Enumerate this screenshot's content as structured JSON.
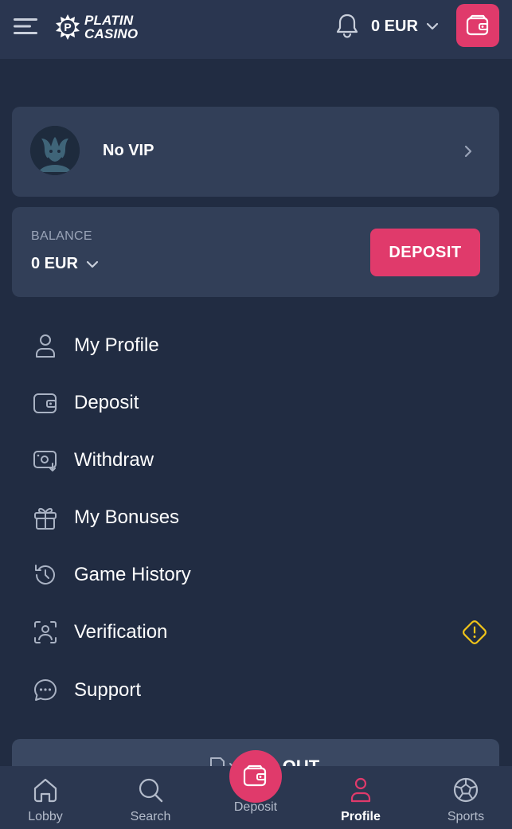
{
  "header": {
    "brand_line1": "PLATIN",
    "brand_line2": "CASINO",
    "balance": "0 EUR"
  },
  "vip": {
    "label": "No VIP"
  },
  "balance_card": {
    "label": "BALANCE",
    "value": "0 EUR",
    "deposit_label": "DEPOSIT"
  },
  "menu": {
    "items": [
      {
        "label": "My Profile",
        "icon": "user-icon"
      },
      {
        "label": "Deposit",
        "icon": "wallet-icon"
      },
      {
        "label": "Withdraw",
        "icon": "withdraw-icon"
      },
      {
        "label": "My Bonuses",
        "icon": "gift-icon"
      },
      {
        "label": "Game History",
        "icon": "history-icon"
      },
      {
        "label": "Verification",
        "icon": "verification-icon"
      },
      {
        "label": "Support",
        "icon": "chat-icon"
      }
    ]
  },
  "logout": {
    "label": "OUT"
  },
  "bottom_nav": {
    "items": [
      {
        "label": "Lobby",
        "icon": "home-icon"
      },
      {
        "label": "Search",
        "icon": "search-icon"
      },
      {
        "label": "Deposit",
        "icon": "wallet-icon"
      },
      {
        "label": "Profile",
        "icon": "user-icon",
        "active": true
      },
      {
        "label": "Sports",
        "icon": "soccer-ball-icon"
      }
    ]
  },
  "colors": {
    "background": "#212c42",
    "header": "#2a3650",
    "card": "#323f58",
    "accent": "#e03a6b",
    "warning": "#f0c419"
  }
}
